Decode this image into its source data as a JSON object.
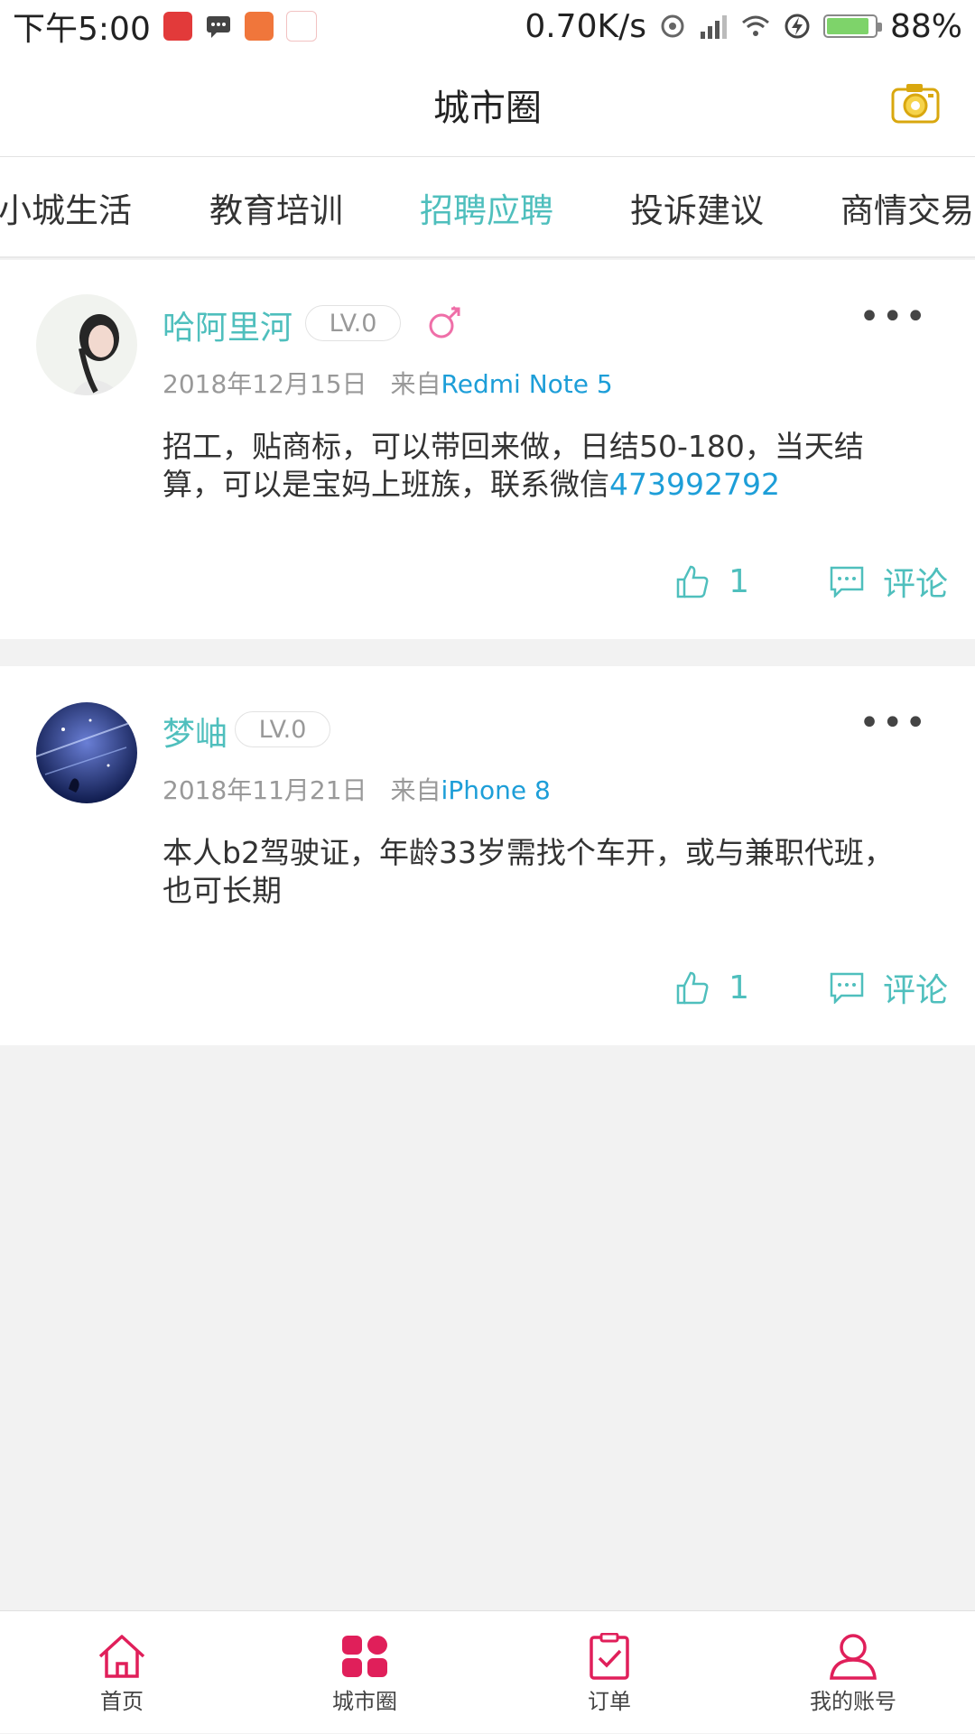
{
  "status_bar": {
    "time": "下午5:00",
    "speed": "0.70K/s",
    "battery": "88%",
    "battery_level": 0.88,
    "battery_color": "#7ed36a"
  },
  "header": {
    "title": "城市圈",
    "camera_icon": "camera-icon"
  },
  "tabs": [
    {
      "label": "小城生活"
    },
    {
      "label": "教育培训"
    },
    {
      "label": "招聘应聘",
      "active": true
    },
    {
      "label": "投诉建议"
    },
    {
      "label": "商情交易"
    }
  ],
  "posts": [
    {
      "username": "哈阿里河",
      "level": "LV.0",
      "gender_icon": "male-female-icon",
      "date": "2018年12月15日",
      "from_prefix": "来自",
      "device": "Redmi Note 5",
      "content_text": "招工，贴商标，可以带回来做，日结50-180，当天结算，可以是宝妈上班族，联系微信",
      "content_phone": "473992792",
      "likes": "1",
      "comment_label": "评论"
    },
    {
      "username": "梦岫",
      "level": "LV.0",
      "date": "2018年11月21日",
      "from_prefix": "来自",
      "device": "iPhone 8",
      "content_text": "本人b2驾驶证，年龄33岁需找个车开，或与兼职代班，也可长期",
      "likes": "1",
      "comment_label": "评论"
    }
  ],
  "bottom_nav": [
    {
      "label": "首页",
      "icon": "home-icon"
    },
    {
      "label": "城市圈",
      "icon": "grid-icon",
      "active": true
    },
    {
      "label": "订单",
      "icon": "clipboard-check-icon"
    },
    {
      "label": "我的账号",
      "icon": "user-icon"
    }
  ],
  "colors": {
    "accent": "#4fbfbd",
    "link": "#1d9ed8",
    "nav": "#e01f5a",
    "gender": "#ef6fa8"
  }
}
